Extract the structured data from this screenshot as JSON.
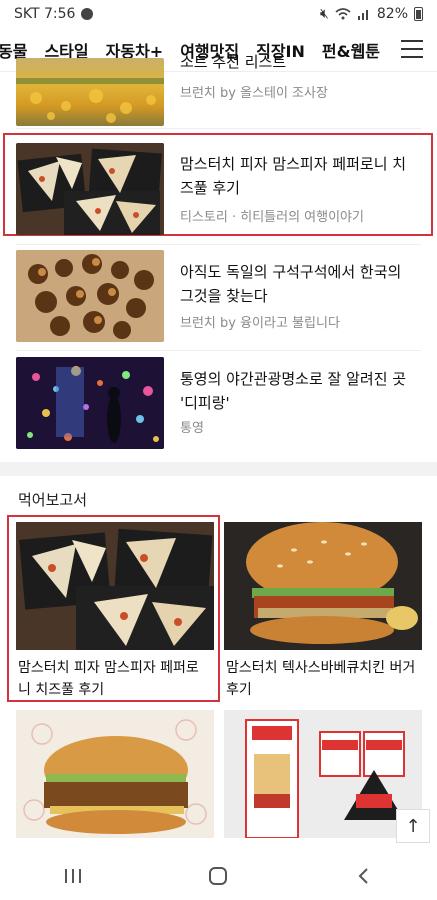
{
  "status_bar": {
    "carrier_time": "SKT 7:56",
    "battery": "82%"
  },
  "nav": {
    "tabs": [
      "동물",
      "스타일",
      "자동차+",
      "여행맛집",
      "직장IN",
      "펀&웹툰"
    ]
  },
  "list_items": [
    {
      "title": "소트 추천 리스트",
      "source": "브런치 by 올스테이 조사장"
    },
    {
      "title": "맘스터치 피자 맘스피자 페퍼로니 치즈풀 후기",
      "source": "티스토리 · 히티틀러의 여행이야기"
    },
    {
      "title": "아직도 독일의 구석구석에서 한국의 그것을 찾는다",
      "source": "브런치 by 융이라고 불립니다"
    },
    {
      "title": "통영의 야간관광명소로 잘 알려진 곳 '디피랑'",
      "source": "통영"
    }
  ],
  "section": {
    "title": "먹어보고서"
  },
  "grid_cards": [
    {
      "title": "맘스터치 피자 맘스피자 페퍼로니 치즈풀 후기"
    },
    {
      "title": "맘스터치 텍사스바베큐치킨 버거 후기"
    },
    {
      "title": ""
    },
    {
      "title": ""
    }
  ],
  "icons": {
    "menu": "hamburger-icon",
    "scroll_top": "arrow-up-icon",
    "recent_apps": "recent-apps-icon",
    "home": "home-icon",
    "back": "back-icon"
  },
  "colors": {
    "highlight": "#d1343c"
  }
}
